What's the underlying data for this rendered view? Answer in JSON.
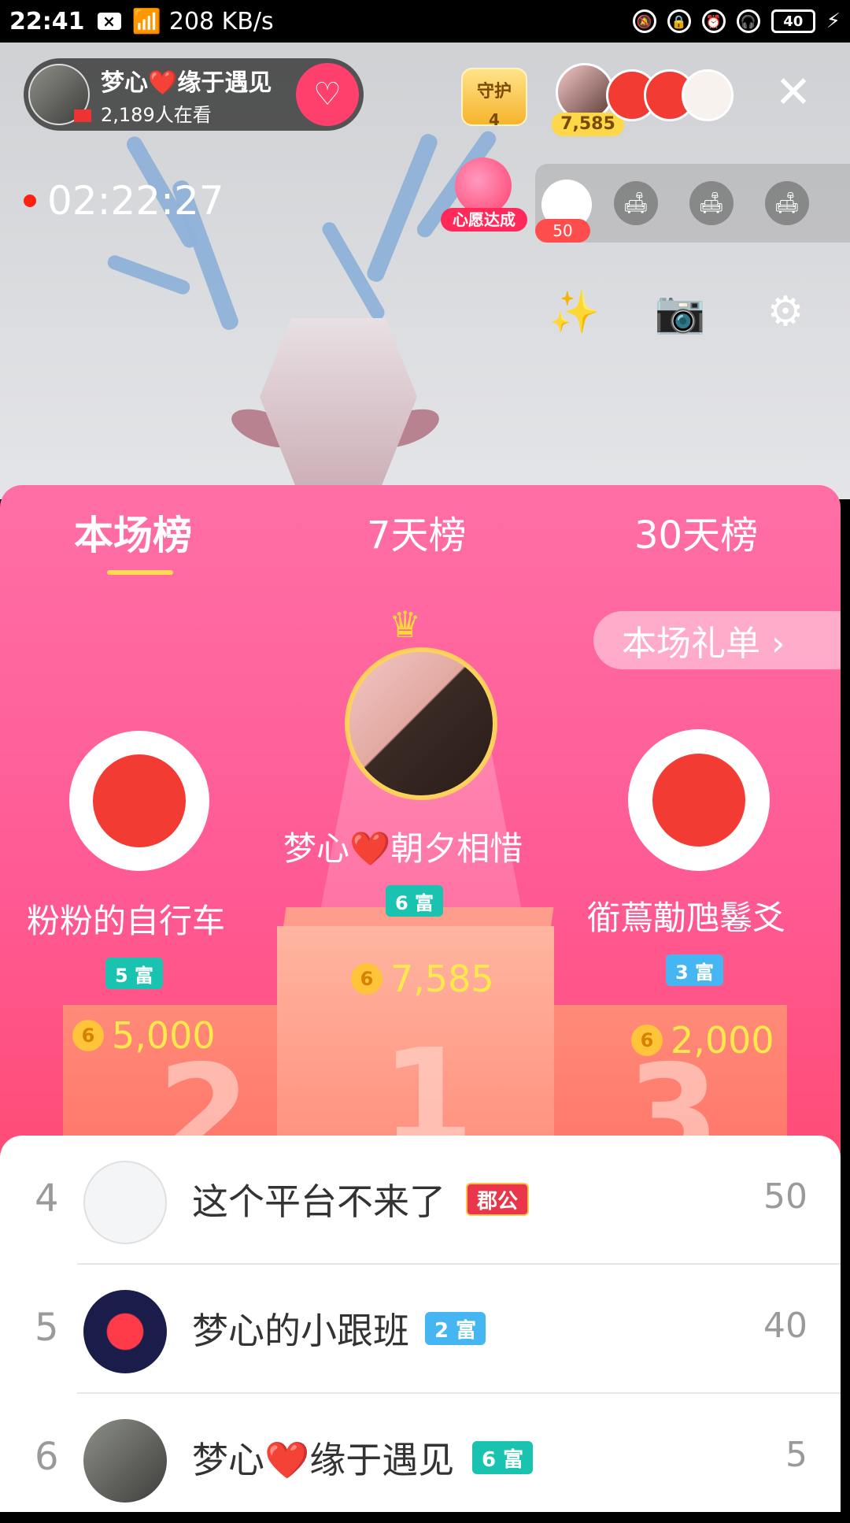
{
  "status_bar": {
    "time": "22:41",
    "net_speed": "208 KB/s",
    "battery": "40"
  },
  "live": {
    "host_name": "梦心❤️缘于遇见",
    "viewers": "2,189人在看",
    "guard_label": "守护",
    "guard_count": "4",
    "top_viewer_contribution": "7,585",
    "timer": "02:22:27",
    "wish_label": "心愿达成",
    "fan_count": "50"
  },
  "leaderboard": {
    "tabs": [
      "本场榜",
      "7天榜",
      "30天榜"
    ],
    "gift_list_btn": "本场礼单 ›",
    "podium_numbers": [
      "2",
      "1",
      "3"
    ],
    "top3": [
      {
        "rank": "1",
        "name": "梦心❤️朝夕相惜",
        "badge": "6 富",
        "badge_color": "#19c3b0",
        "score": "7,585"
      },
      {
        "rank": "2",
        "name": "粉粉的自行车",
        "badge": "5 富",
        "badge_color": "#19c3b0",
        "score": "5,000"
      },
      {
        "rank": "3",
        "name": "衜蔦勱虺鬈爻",
        "badge": "3 富",
        "badge_color": "#45b6f2",
        "score": "2,000"
      }
    ],
    "list": [
      {
        "rank": "4",
        "name": "这个平台不来了",
        "badge": "郡公",
        "badge_color": "#e9364a",
        "score": "50"
      },
      {
        "rank": "5",
        "name": "梦心的小跟班",
        "badge": "2 富",
        "badge_color": "#45b6f2",
        "score": "40"
      },
      {
        "rank": "6",
        "name": "梦心❤️缘于遇见",
        "badge": "6 富",
        "badge_color": "#19c3b0",
        "score": "5"
      }
    ]
  },
  "colors": {
    "sheet_pink": "#ff5993",
    "coin_yellow": "#ffe94c",
    "accent_red": "#f23c33"
  }
}
